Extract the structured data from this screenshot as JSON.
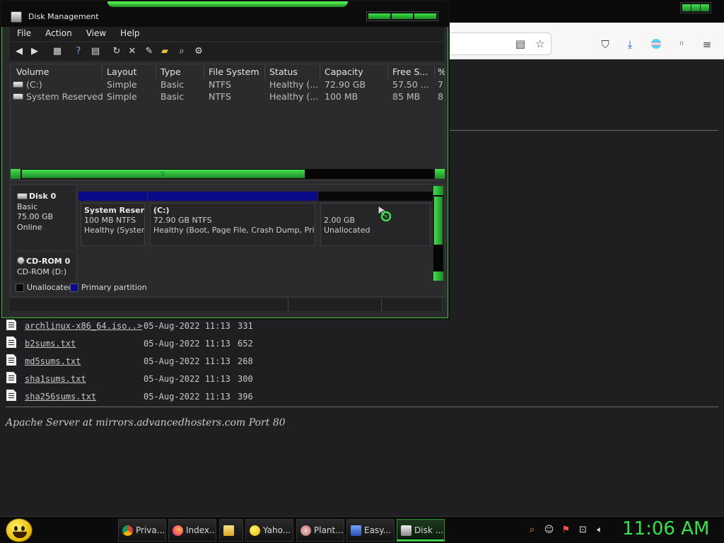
{
  "window": {
    "title": "Disk Management"
  },
  "menu": [
    "File",
    "Action",
    "View",
    "Help"
  ],
  "volume_table": {
    "columns": [
      "Volume",
      "Layout",
      "Type",
      "File System",
      "Status",
      "Capacity",
      "Free S...",
      "%"
    ],
    "rows": [
      [
        "(C:)",
        "Simple",
        "Basic",
        "NTFS",
        "Healthy (...",
        "72.90 GB",
        "57.50 ...",
        "7"
      ],
      [
        "System Reserved",
        "Simple",
        "Basic",
        "NTFS",
        "Healthy (...",
        "100 MB",
        "85 MB",
        "8"
      ]
    ]
  },
  "disks": [
    {
      "name": "Disk 0",
      "type": "Basic",
      "size": "75.00 GB",
      "state": "Online",
      "partitions": [
        {
          "title": "System Reserv",
          "line2": "100 MB NTFS",
          "line3": "Healthy (System,",
          "kind": "primary"
        },
        {
          "title": "(C:)",
          "line2": "72.90 GB NTFS",
          "line3": "Healthy (Boot, Page File, Crash Dump, Primary",
          "kind": "primary"
        },
        {
          "title": "",
          "line2": "2.00 GB",
          "line3": "Unallocated",
          "kind": "unallocated"
        }
      ]
    },
    {
      "name": "CD-ROM 0",
      "line2": "CD-ROM (D:)"
    }
  ],
  "legend": {
    "unallocated": "Unallocated",
    "primary": "Primary partition"
  },
  "colors": {
    "primary": "#0b0b8a",
    "unallocated": "#080808",
    "accent": "#3fe04a"
  },
  "browser": {
    "files": [
      {
        "name": "archlinux-x86_64.iso..>",
        "date": "05-Aug-2022 11:13",
        "size": "331"
      },
      {
        "name": "b2sums.txt",
        "date": "05-Aug-2022 11:13",
        "size": "652"
      },
      {
        "name": "md5sums.txt",
        "date": "05-Aug-2022 11:13",
        "size": "268"
      },
      {
        "name": "sha1sums.txt",
        "date": "05-Aug-2022 11:13",
        "size": "300"
      },
      {
        "name": "sha256sums.txt",
        "date": "05-Aug-2022 11:13",
        "size": "396"
      }
    ],
    "server_signature": "Apache Server at mirrors.advancedhosters.com Port 80"
  },
  "taskbar": {
    "tasks": [
      "Priva...",
      "Index...",
      "",
      "Yaho...",
      "Plant...",
      "Easy...",
      "Disk ..."
    ],
    "clock": "11:06 AM"
  }
}
